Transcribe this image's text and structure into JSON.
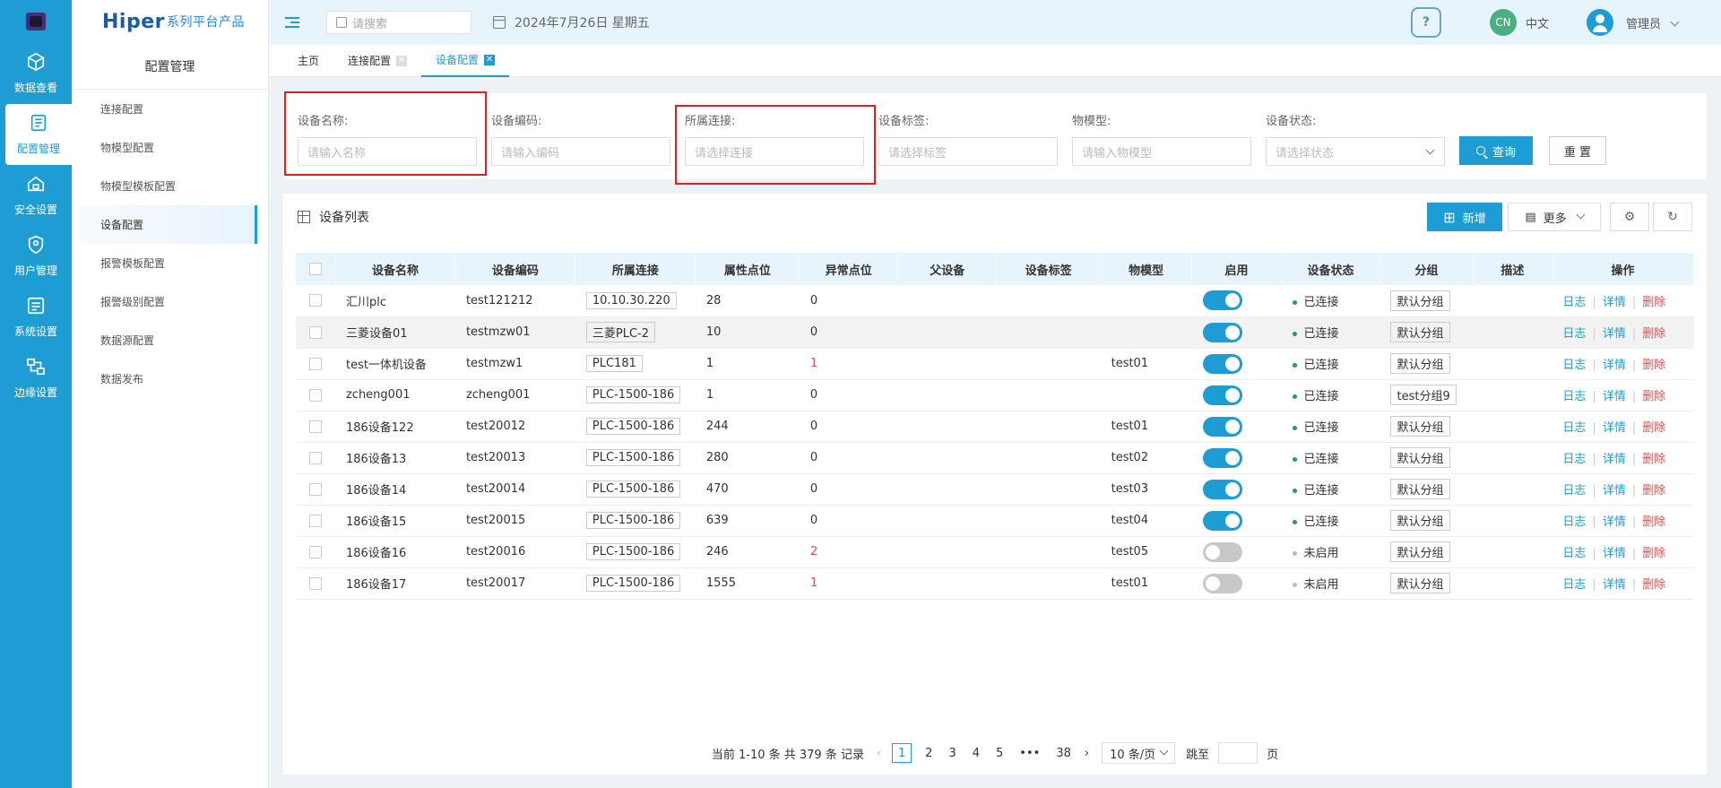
{
  "rail": [
    {
      "label": "数据查看",
      "icon": "cube-icon"
    },
    {
      "label": "配置管理",
      "icon": "config-icon"
    },
    {
      "label": "安全设置",
      "icon": "lock-icon"
    },
    {
      "label": "用户管理",
      "icon": "shield-user-icon"
    },
    {
      "label": "系统设置",
      "icon": "system-icon"
    },
    {
      "label": "边缘设置",
      "icon": "edge-icon"
    }
  ],
  "brand": {
    "name": "Hiper",
    "sub": "系列平台产品"
  },
  "sidebar": {
    "title": "配置管理",
    "items": [
      "连接配置",
      "物模型配置",
      "物模型模板配置",
      "设备配置",
      "报警模板配置",
      "报警级别配置",
      "数据源配置",
      "数据发布"
    ]
  },
  "header": {
    "search_placeholder": "请搜索",
    "date": "2024年7月26日 星期五",
    "lang_badge": "CN",
    "lang": "中文",
    "user": "管理员"
  },
  "tabs": [
    {
      "label": "主页"
    },
    {
      "label": "连接配置"
    },
    {
      "label": "设备配置"
    }
  ],
  "filter": {
    "name": {
      "label": "设备名称:",
      "placeholder": "请输入名称"
    },
    "code": {
      "label": "设备编码:",
      "placeholder": "请输入编码"
    },
    "conn": {
      "label": "所属连接:",
      "placeholder": "请选择连接"
    },
    "tag": {
      "label": "设备标签:",
      "placeholder": "请选择标签"
    },
    "model": {
      "label": "物模型:",
      "placeholder": "请输入物模型"
    },
    "status": {
      "label": "设备状态:",
      "placeholder": "请选择状态"
    },
    "query": "查询",
    "reset": "重 置"
  },
  "list": {
    "title": "设备列表",
    "add": "新增",
    "more": "更多",
    "columns": [
      "设备名称",
      "设备编码",
      "所属连接",
      "属性点位",
      "异常点位",
      "父设备",
      "设备标签",
      "物模型",
      "启用",
      "设备状态",
      "分组",
      "描述",
      "操作"
    ],
    "rows": [
      {
        "name": "汇川plc",
        "code": "test121212",
        "conn": "10.10.30.220",
        "props": "28",
        "abn": "0",
        "model": "",
        "enabled": true,
        "status": "已连接",
        "group": "默认分组"
      },
      {
        "name": "三菱设备01",
        "code": "testmzw01",
        "conn": "三菱PLC-2",
        "props": "10",
        "abn": "0",
        "model": "",
        "enabled": true,
        "status": "已连接",
        "group": "默认分组"
      },
      {
        "name": "test一体机设备",
        "code": "testmzw1",
        "conn": "PLC181",
        "props": "1",
        "abn": "1",
        "model": "test01",
        "enabled": true,
        "status": "已连接",
        "group": "默认分组"
      },
      {
        "name": "zcheng001",
        "code": "zcheng001",
        "conn": "PLC-1500-186",
        "props": "1",
        "abn": "0",
        "model": "",
        "enabled": true,
        "status": "已连接",
        "group": "test分组9"
      },
      {
        "name": "186设备122",
        "code": "test20012",
        "conn": "PLC-1500-186",
        "props": "244",
        "abn": "0",
        "model": "test01",
        "enabled": true,
        "status": "已连接",
        "group": "默认分组"
      },
      {
        "name": "186设备13",
        "code": "test20013",
        "conn": "PLC-1500-186",
        "props": "280",
        "abn": "0",
        "model": "test02",
        "enabled": true,
        "status": "已连接",
        "group": "默认分组"
      },
      {
        "name": "186设备14",
        "code": "test20014",
        "conn": "PLC-1500-186",
        "props": "470",
        "abn": "0",
        "model": "test03",
        "enabled": true,
        "status": "已连接",
        "group": "默认分组"
      },
      {
        "name": "186设备15",
        "code": "test20015",
        "conn": "PLC-1500-186",
        "props": "639",
        "abn": "0",
        "model": "test04",
        "enabled": true,
        "status": "已连接",
        "group": "默认分组"
      },
      {
        "name": "186设备16",
        "code": "test20016",
        "conn": "PLC-1500-186",
        "props": "246",
        "abn": "2",
        "model": "test05",
        "enabled": false,
        "status": "未启用",
        "group": "默认分组"
      },
      {
        "name": "186设备17",
        "code": "test20017",
        "conn": "PLC-1500-186",
        "props": "1555",
        "abn": "1",
        "model": "test01",
        "enabled": false,
        "status": "未启用",
        "group": "默认分组"
      }
    ],
    "actions": {
      "log": "日志",
      "detail": "详情",
      "delete": "删除"
    }
  },
  "pager": {
    "summary": "当前 1-10 条 共 379 条 记录",
    "pages": [
      "1",
      "2",
      "3",
      "4",
      "5",
      "•••",
      "38"
    ],
    "size": "10 条/页",
    "jump": "跳至",
    "page_unit": "页"
  },
  "colors": {
    "accent": "#1e9dd5",
    "danger": "#e05050",
    "highlight": "#e02020"
  }
}
